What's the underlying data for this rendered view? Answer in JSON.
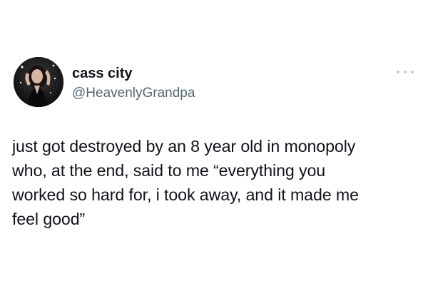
{
  "author": {
    "display_name": "cass city",
    "handle": "@HeavenlyGrandpa",
    "avatar_icon": "profile-photo"
  },
  "more_icon": "more-options-icon",
  "tweet": {
    "text": "just got destroyed by an 8 year old in monopoly\nwho, at the end, said to me “everything you\nworked so hard for, i took away, and it made me\nfeel good”"
  },
  "colors": {
    "text": "#0f1419",
    "secondary": "#536471",
    "background": "#ffffff"
  }
}
